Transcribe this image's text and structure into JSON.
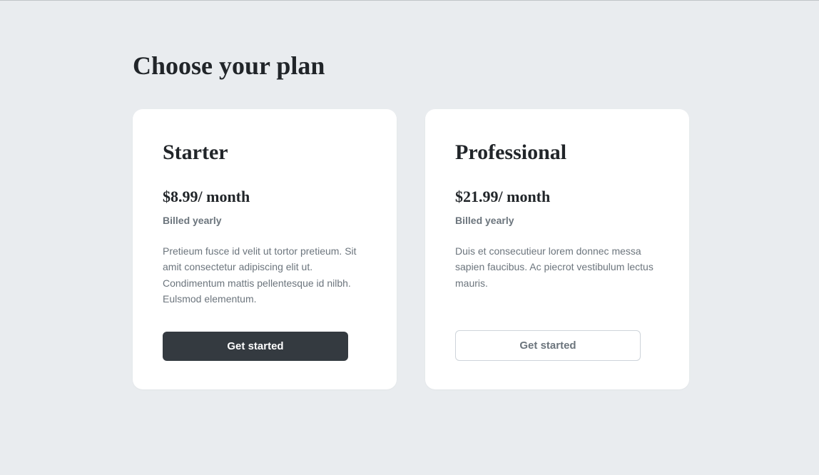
{
  "title": "Choose your plan",
  "plans": [
    {
      "name": "Starter",
      "price": "$8.99/ month",
      "billing": "Billed yearly",
      "description": "Pretieum fusce id velit ut tortor pretieum. Sit amit consectetur adipiscing elit ut. Condimentum mattis pellentesque id nilbh. Eulsmod elementum.",
      "cta": "Get started"
    },
    {
      "name": "Professional",
      "price": "$21.99/ month",
      "billing": "Billed yearly",
      "description": "Duis et consecutieur lorem donnec messa sapien faucibus. Ac piecrot vestibulum lectus mauris.",
      "cta": "Get started"
    }
  ]
}
